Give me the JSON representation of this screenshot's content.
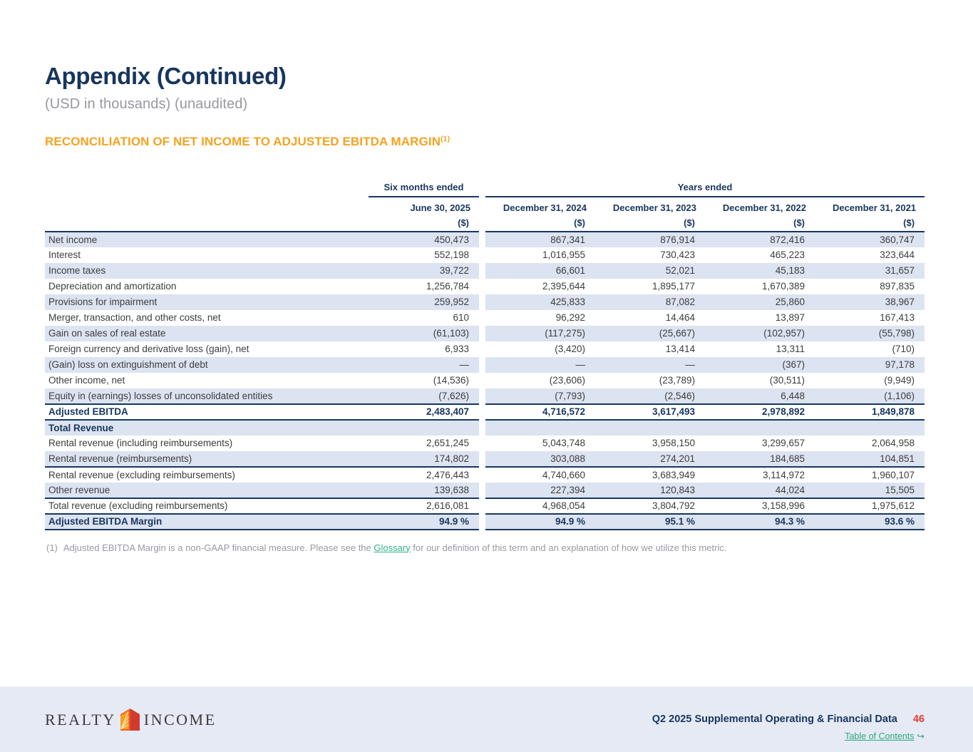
{
  "page": {
    "title": "Appendix (Continued)",
    "subtitle": "(USD in thousands) (unaudited)",
    "section_heading": "RECONCILIATION OF NET INCOME TO ADJUSTED EBITDA MARGIN",
    "section_heading_sup": "(1)"
  },
  "colors": {
    "navy": "#18365f",
    "orange_heading": "#f6a21e",
    "row_stripe": "#dce3f1",
    "footer_bg": "#e5eaf4",
    "page_number_red": "#e63c2f",
    "link_green": "#2fa87d",
    "logo_red": "#d23a2e",
    "logo_orange": "#f5a01e"
  },
  "table": {
    "group_headers": [
      {
        "label": "Six months ended"
      },
      {
        "label": "Years ended"
      }
    ],
    "columns": [
      "June 30, 2025",
      "December 31, 2024",
      "December 31, 2023",
      "December 31, 2022",
      "December 31, 2021"
    ],
    "units": [
      "($)",
      "($)",
      "($)",
      "($)",
      "($)"
    ],
    "rows": [
      {
        "label": "Net income",
        "values": [
          "450,473",
          "867,341",
          "876,914",
          "872,416",
          "360,747"
        ],
        "stripe": true,
        "bold": false,
        "rule": false
      },
      {
        "label": "Interest",
        "values": [
          "552,198",
          "1,016,955",
          "730,423",
          "465,223",
          "323,644"
        ],
        "stripe": false,
        "bold": false,
        "rule": false
      },
      {
        "label": "Income taxes",
        "values": [
          "39,722",
          "66,601",
          "52,021",
          "45,183",
          "31,657"
        ],
        "stripe": true,
        "bold": false,
        "rule": false
      },
      {
        "label": "Depreciation and amortization",
        "values": [
          "1,256,784",
          "2,395,644",
          "1,895,177",
          "1,670,389",
          "897,835"
        ],
        "stripe": false,
        "bold": false,
        "rule": false
      },
      {
        "label": "Provisions for impairment",
        "values": [
          "259,952",
          "425,833",
          "87,082",
          "25,860",
          "38,967"
        ],
        "stripe": true,
        "bold": false,
        "rule": false
      },
      {
        "label": "Merger, transaction, and other costs, net",
        "values": [
          "610",
          "96,292",
          "14,464",
          "13,897",
          "167,413"
        ],
        "stripe": false,
        "bold": false,
        "rule": false
      },
      {
        "label": "Gain on sales of real estate",
        "values": [
          "(61,103)",
          "(117,275)",
          "(25,667)",
          "(102,957)",
          "(55,798)"
        ],
        "stripe": true,
        "bold": false,
        "rule": false
      },
      {
        "label": "Foreign currency and derivative loss (gain), net",
        "values": [
          "6,933",
          "(3,420)",
          "13,414",
          "13,311",
          "(710)"
        ],
        "stripe": false,
        "bold": false,
        "rule": false
      },
      {
        "label": "(Gain) loss on extinguishment of debt",
        "values": [
          "—",
          "—",
          "—",
          "(367)",
          "97,178"
        ],
        "stripe": true,
        "bold": false,
        "rule": false
      },
      {
        "label": "Other income, net",
        "values": [
          "(14,536)",
          "(23,606)",
          "(23,789)",
          "(30,511)",
          "(9,949)"
        ],
        "stripe": false,
        "bold": false,
        "rule": false
      },
      {
        "label": "Equity in (earnings) losses of unconsolidated entities",
        "values": [
          "(7,626)",
          "(7,793)",
          "(2,546)",
          "6,448",
          "(1,106)"
        ],
        "stripe": true,
        "bold": false,
        "rule": true
      },
      {
        "label": "Adjusted EBITDA",
        "values": [
          "2,483,407",
          "4,716,572",
          "3,617,493",
          "2,978,892",
          "1,849,878"
        ],
        "stripe": false,
        "bold": true,
        "rule": true
      },
      {
        "label": "Total Revenue",
        "values": [
          "",
          "",
          "",
          "",
          ""
        ],
        "stripe": true,
        "bold": true,
        "rule": false
      },
      {
        "label": "Rental revenue (including reimbursements)",
        "values": [
          "2,651,245",
          "5,043,748",
          "3,958,150",
          "3,299,657",
          "2,064,958"
        ],
        "stripe": false,
        "bold": false,
        "rule": false
      },
      {
        "label": "Rental revenue (reimbursements)",
        "values": [
          "174,802",
          "303,088",
          "274,201",
          "184,685",
          "104,851"
        ],
        "stripe": true,
        "bold": false,
        "rule": true
      },
      {
        "label": "Rental revenue (excluding reimbursements)",
        "values": [
          "2,476,443",
          "4,740,660",
          "3,683,949",
          "3,114,972",
          "1,960,107"
        ],
        "stripe": false,
        "bold": false,
        "rule": false
      },
      {
        "label": "Other revenue",
        "values": [
          "139,638",
          "227,394",
          "120,843",
          "44,024",
          "15,505"
        ],
        "stripe": true,
        "bold": false,
        "rule": true
      },
      {
        "label": "Total revenue (excluding reimbursements)",
        "values": [
          "2,616,081",
          "4,968,054",
          "3,804,792",
          "3,158,996",
          "1,975,612"
        ],
        "stripe": false,
        "bold": false,
        "rule": true
      },
      {
        "label": "Adjusted EBITDA Margin",
        "values": [
          "94.9 %",
          "94.9 %",
          "95.1 %",
          "94.3 %",
          "93.6 %"
        ],
        "stripe": true,
        "bold": true,
        "rule": true
      }
    ]
  },
  "footnote": {
    "marker": "(1)",
    "text_before_link": "Adjusted EBITDA Margin is a non-GAAP financial measure. Please see the ",
    "link_label": "Glossary",
    "text_after_link": " for our definition of this term and an explanation of how we utilize this metric."
  },
  "footer": {
    "logo_left": "REALTY",
    "logo_right": "INCOME",
    "doc_title": "Q2 2025 Supplemental Operating & Financial Data",
    "page_number": "46",
    "toc_label": "Table of Contents",
    "toc_arrow": "↪"
  }
}
